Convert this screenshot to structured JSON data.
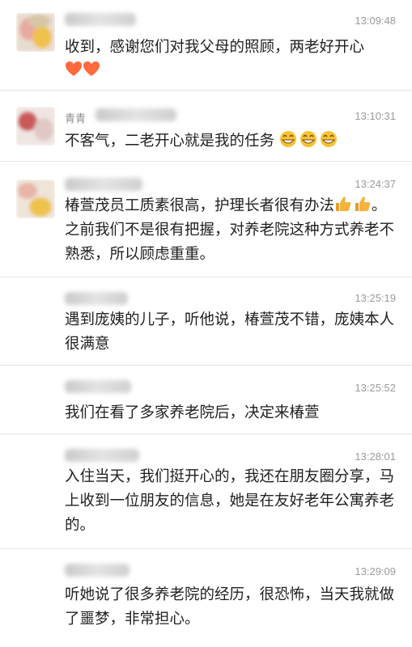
{
  "messages": [
    {
      "name": "",
      "time": "13:09:48",
      "text": "收到，感谢您们对我父母的照顾，两老好开心",
      "emoji": "❤️❤️"
    },
    {
      "name": "青青",
      "time": "13:10:31",
      "text": "不客气，二老开心就是我的任务",
      "emoji": "😁😁😁"
    },
    {
      "name": "",
      "time": "13:24:37",
      "text1": "椿萱茂员工质素很高，护理长者很有办法",
      "emoji": "👍👍",
      "text2": "。之前我们不是很有把握，对养老院这种方式养老不熟悉，所以顾虑重重。"
    },
    {
      "name": "",
      "time": "13:25:19",
      "text": "遇到庞姨的儿子，听他说，椿萱茂不错，庞姨本人很满意"
    },
    {
      "name": "",
      "time": "13:25:52",
      "text": "我们在看了多家养老院后，决定来椿萱"
    },
    {
      "name": "",
      "time": "13:28:01",
      "text": "入住当天，我们挺开心的，我还在朋友圈分享，马上收到一位朋友的信息，她是在友好老年公寓养老的。"
    },
    {
      "name": "",
      "time": "13:29:09",
      "text": "听她说了很多养老院的经历，很恐怖，当天我就做了噩梦，非常担心。"
    }
  ],
  "colors": {
    "heart": "#ff6a3d",
    "grin": "#f6c233",
    "thumb": "#f5b23d"
  },
  "icons": {
    "avatar": "blurred-avatar-icon",
    "heart": "heart-icon",
    "grin": "grin-emoji-icon",
    "thumb": "thumbs-up-icon"
  }
}
